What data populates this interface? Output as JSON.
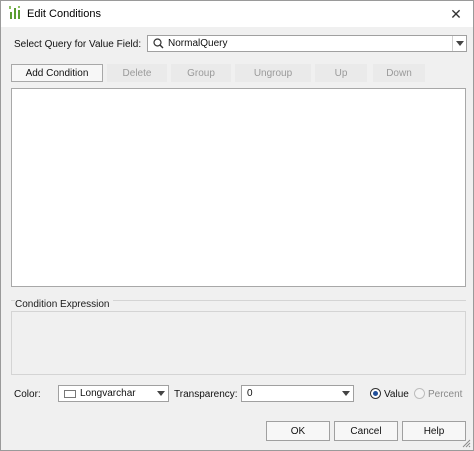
{
  "window": {
    "title": "Edit Conditions",
    "close_glyph": "✕"
  },
  "query": {
    "label": "Select Query for Value Field:",
    "value": "NormalQuery"
  },
  "toolbar": {
    "add": "Add Condition",
    "delete": "Delete",
    "group": "Group",
    "ungroup": "Ungroup",
    "up": "Up",
    "down": "Down"
  },
  "expression": {
    "label": "Condition Expression"
  },
  "color": {
    "label": "Color:",
    "value": "Longvarchar"
  },
  "transparency": {
    "label": "Transparency:",
    "value": "0"
  },
  "mode": {
    "value_label": "Value",
    "percent_label": "Percent",
    "selected": "value"
  },
  "footer": {
    "ok": "OK",
    "cancel": "Cancel",
    "help": "Help"
  },
  "colors": {
    "accent": "#1f4e99",
    "icon_green": "#5a9e2f"
  }
}
